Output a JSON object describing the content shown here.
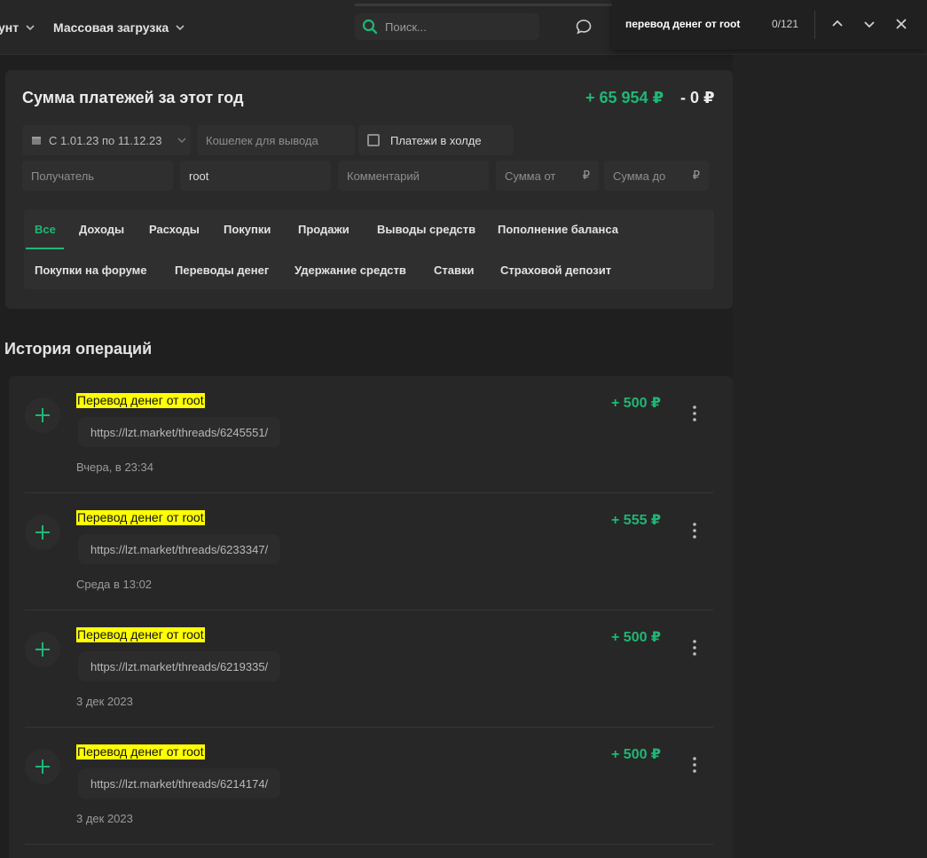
{
  "header": {
    "nav_account": "унт",
    "nav_bulk": "Массовая загрузка",
    "search_placeholder": "Поиск..."
  },
  "findbar": {
    "query": "перевод денег от root",
    "count": "0/121"
  },
  "summary": {
    "title": "Сумма платежей за этот год",
    "income": "+ 65 954 ₽",
    "expense": "- 0 ₽"
  },
  "filters": {
    "date_range": "С 1.01.23 по 11.12.23",
    "wallet_placeholder": "Кошелек для вывода",
    "hold_label": "Платежи в холде",
    "recipient_placeholder": "Получатель",
    "sender_value": "root",
    "comment_placeholder": "Комментарий",
    "sum_from_placeholder": "Сумма от",
    "sum_to_placeholder": "Сумма до",
    "currency": "₽"
  },
  "tabs": [
    {
      "label": "Все",
      "active": true
    },
    {
      "label": "Доходы"
    },
    {
      "label": "Расходы"
    },
    {
      "label": "Покупки"
    },
    {
      "label": "Продажи"
    },
    {
      "label": "Выводы средств"
    },
    {
      "label": "Пополнение баланса"
    },
    {
      "label": "Покупки на форуме"
    },
    {
      "label": "Переводы денег"
    },
    {
      "label": "Удержание средств"
    },
    {
      "label": "Ставки"
    },
    {
      "label": "Страховой депозит"
    }
  ],
  "history": {
    "title": "История операций",
    "operations": [
      {
        "title": "Перевод денег от root",
        "link": "https://lzt.market/threads/6245551/",
        "time": "Вчера, в 23:34",
        "amount": "+ 500 ₽"
      },
      {
        "title": "Перевод денег от root",
        "link": "https://lzt.market/threads/6233347/",
        "time": "Среда в 13:02",
        "amount": "+ 555 ₽"
      },
      {
        "title": "Перевод денег от root",
        "link": "https://lzt.market/threads/6219335/",
        "time": "3 дек 2023",
        "amount": "+ 500 ₽"
      },
      {
        "title": "Перевод денег от root",
        "link": "https://lzt.market/threads/6214174/",
        "time": "3 дек 2023",
        "amount": "+ 500 ₽"
      }
    ]
  },
  "colors": {
    "accent": "#1fb775",
    "highlight": "#ffff00",
    "background": "#1f1f1f"
  }
}
